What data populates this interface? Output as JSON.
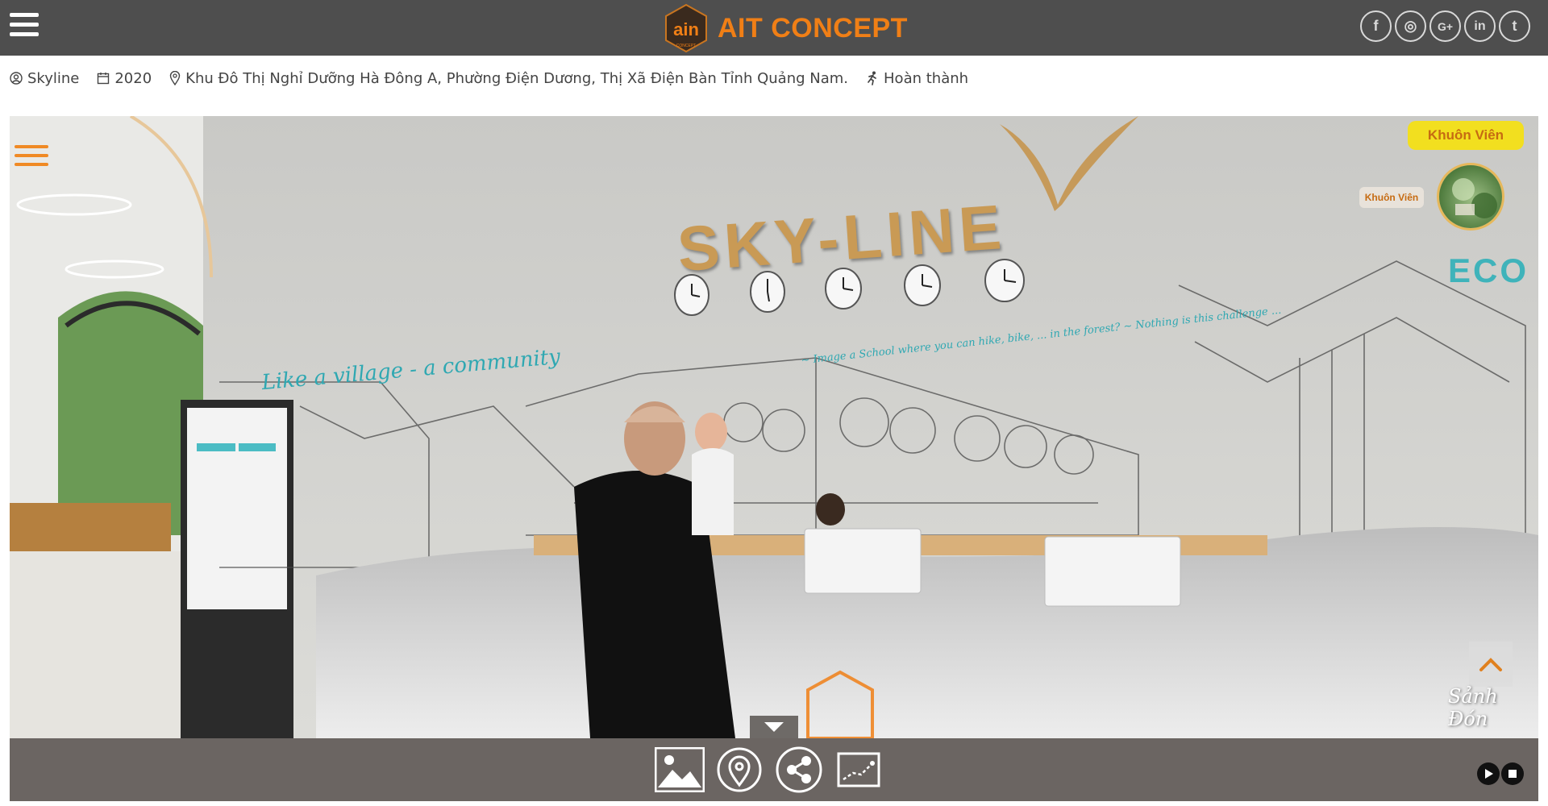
{
  "header": {
    "menu_icon": "hamburger-icon",
    "brand_name": "AIT CONCEPT",
    "brand_color": "#f07f16",
    "background": "#4e4e4e",
    "socials": [
      {
        "name": "facebook",
        "glyph": "f"
      },
      {
        "name": "instagram",
        "glyph": "◎"
      },
      {
        "name": "google-plus",
        "glyph": "G+"
      },
      {
        "name": "linkedin",
        "glyph": "in"
      },
      {
        "name": "twitter",
        "glyph": "t"
      }
    ]
  },
  "project_info": {
    "name": "Skyline",
    "year": "2020",
    "address": "Khu Đô Thị Nghỉ Dưỡng Hà Đông A, Phường Điện Dương, Thị Xã Điện Bàn Tỉnh Quảng Nam.",
    "status": "Hoàn thành"
  },
  "viewer": {
    "wall_sign": "SKY-LINE",
    "eco_text": "ECO",
    "quote_main": "Like a village - a community",
    "quote_small": "~ Image a School where you can hike, bike, ... in the forest? ~ Nothing is this challenge ...",
    "scene_label": "Khuôn Viên",
    "thumb_label": "Khuôn Viên",
    "current_scene": "Sảnh Đón",
    "label_color": "#f2df1f"
  },
  "toolbar": {
    "buttons": [
      {
        "name": "gallery-button",
        "icon": "image-icon"
      },
      {
        "name": "location-button",
        "icon": "map-pin-icon"
      },
      {
        "name": "share-button",
        "icon": "share-icon"
      },
      {
        "name": "floorplan-button",
        "icon": "floorplan-icon"
      }
    ],
    "play_icon": "play-icon",
    "stop_icon": "stop-icon"
  }
}
